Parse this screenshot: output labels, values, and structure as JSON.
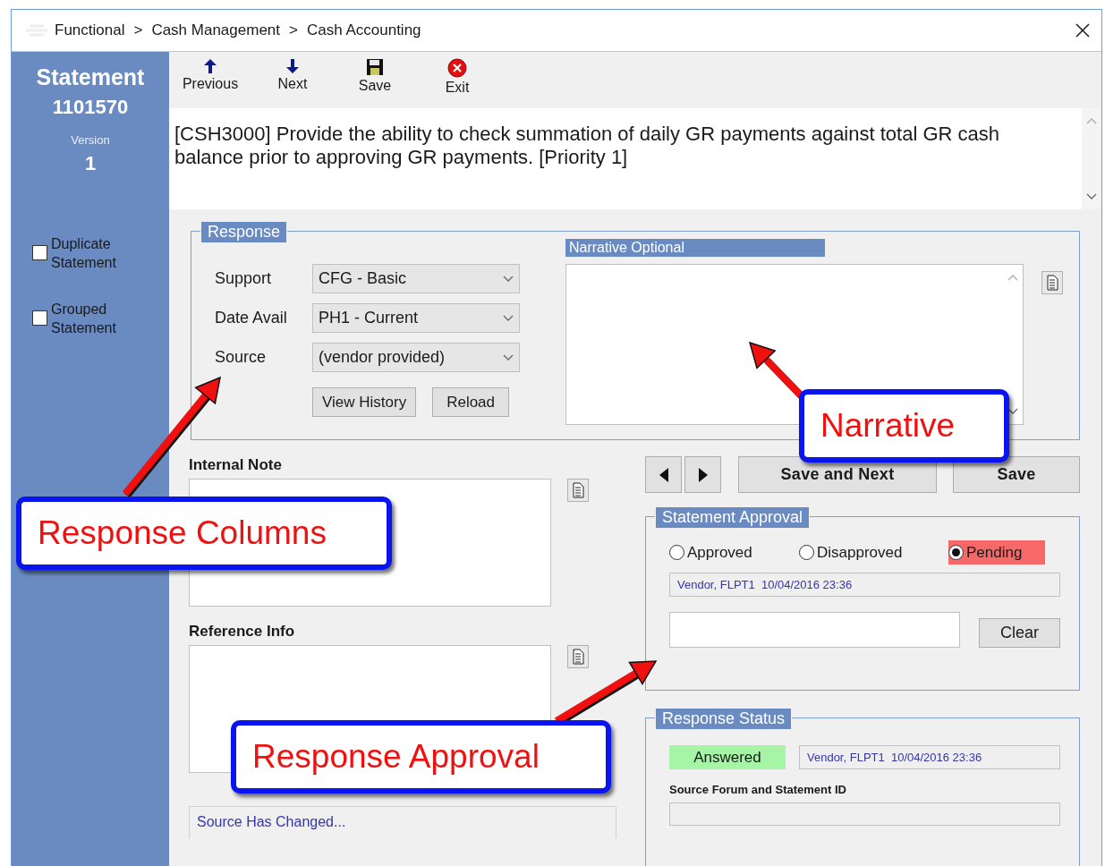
{
  "breadcrumb": {
    "items": [
      "Functional",
      "Cash Management",
      "Cash Accounting"
    ],
    "separators": [
      ">",
      ">"
    ]
  },
  "sidebar": {
    "title": "Statement",
    "number": "1101570",
    "version_label": "Version",
    "version": "1",
    "checkboxes": [
      {
        "label": "Duplicate Statement",
        "checked": false
      },
      {
        "label": "Grouped Statement",
        "checked": false
      }
    ]
  },
  "toolbar": [
    {
      "label": "Previous",
      "kind": "up"
    },
    {
      "label": "Next",
      "kind": "down"
    },
    {
      "label": "Save",
      "kind": "save"
    },
    {
      "label": "Exit",
      "kind": "exit"
    }
  ],
  "requirement": "[CSH3000] Provide the ability to check summation of daily GR payments against total GR cash balance prior to approving GR payments. [Priority 1]",
  "response": {
    "title": "Response",
    "fields": [
      {
        "label": "Support",
        "value": "CFG - Basic"
      },
      {
        "label": "Date Avail",
        "value": "PH1 - Current"
      },
      {
        "label": "Source",
        "value": "(vendor provided)"
      }
    ],
    "buttons": [
      "View History",
      "Reload"
    ],
    "narrative_title": "Narrative Optional"
  },
  "internal_note": {
    "label": "Internal Note"
  },
  "reference_info": {
    "label": "Reference Info"
  },
  "source_changed": "Source Has Changed...",
  "actions": [
    "Save and Next",
    "Save"
  ],
  "statement_approval": {
    "title": "Statement Approval",
    "options": [
      {
        "label": "Approved",
        "selected": false
      },
      {
        "label": "Disapproved",
        "selected": false
      },
      {
        "label": "Pending",
        "selected": true
      }
    ],
    "audit": "Vendor, FLPT1  10/04/2016 23:36",
    "clear_button": "Clear"
  },
  "response_status": {
    "title": "Response Status",
    "status": {
      "label": "Answered",
      "color": "#a6f5a6"
    },
    "audit": "Vendor, FLPT1  10/04/2016 23:36",
    "source_label": "Source Forum and Statement ID"
  },
  "callouts": [
    {
      "text": "Response Columns"
    },
    {
      "text": "Narrative"
    },
    {
      "text": "Response Approval"
    }
  ]
}
